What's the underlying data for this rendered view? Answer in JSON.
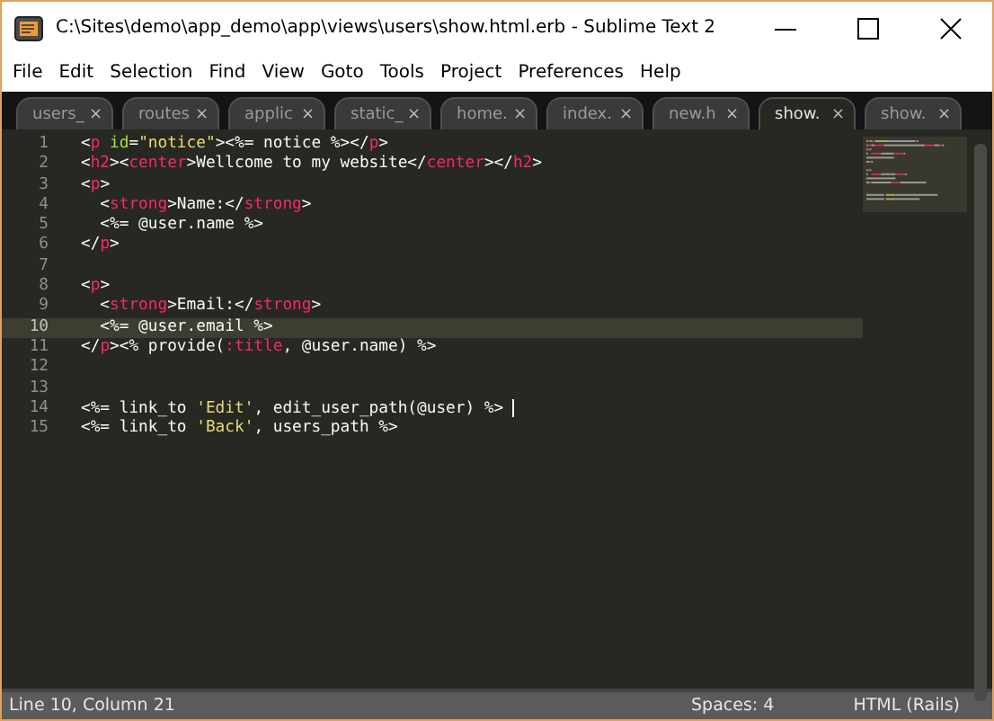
{
  "window": {
    "title": "C:\\Sites\\demo\\app_demo\\app\\views\\users\\show.html.erb - Sublime Text 2"
  },
  "menu": [
    {
      "label": "File"
    },
    {
      "label": "Edit"
    },
    {
      "label": "Selection"
    },
    {
      "label": "Find"
    },
    {
      "label": "View"
    },
    {
      "label": "Goto"
    },
    {
      "label": "Tools"
    },
    {
      "label": "Project"
    },
    {
      "label": "Preferences"
    },
    {
      "label": "Help"
    }
  ],
  "tabs": [
    {
      "label": "users_",
      "close": "×",
      "selected": false
    },
    {
      "label": "routes",
      "close": "×",
      "selected": false
    },
    {
      "label": "applic",
      "close": "×",
      "selected": false
    },
    {
      "label": "static_",
      "close": "×",
      "selected": false
    },
    {
      "label": "home.",
      "close": "×",
      "selected": false
    },
    {
      "label": "index.",
      "close": "×",
      "selected": false
    },
    {
      "label": "new.h",
      "close": "×",
      "selected": false
    },
    {
      "label": "show.",
      "close": "×",
      "selected": true
    },
    {
      "label": "show.",
      "close": "×",
      "selected": false
    }
  ],
  "editor": {
    "lines": [
      {
        "number": "1",
        "current": false,
        "tokens": [
          {
            "kind": "plain",
            "text": "<"
          },
          {
            "kind": "tag",
            "text": "p"
          },
          {
            "kind": "attr",
            "text": " id"
          },
          {
            "kind": "plain",
            "text": "="
          },
          {
            "kind": "string",
            "text": "\"notice\""
          },
          {
            "kind": "plain",
            "text": "><%= notice %></"
          },
          {
            "kind": "tag",
            "text": "p"
          },
          {
            "kind": "plain",
            "text": ">"
          }
        ]
      },
      {
        "number": "2",
        "current": false,
        "tokens": [
          {
            "kind": "plain",
            "text": "<"
          },
          {
            "kind": "tag",
            "text": "h2"
          },
          {
            "kind": "plain",
            "text": "><"
          },
          {
            "kind": "tag",
            "text": "center"
          },
          {
            "kind": "plain",
            "text": ">Wellcome to my website</"
          },
          {
            "kind": "tag",
            "text": "center"
          },
          {
            "kind": "plain",
            "text": "></"
          },
          {
            "kind": "tag",
            "text": "h2"
          },
          {
            "kind": "plain",
            "text": ">"
          }
        ]
      },
      {
        "number": "3",
        "current": false,
        "tokens": [
          {
            "kind": "plain",
            "text": "<"
          },
          {
            "kind": "tag",
            "text": "p"
          },
          {
            "kind": "plain",
            "text": ">"
          }
        ]
      },
      {
        "number": "4",
        "current": false,
        "tokens": [
          {
            "kind": "plain",
            "text": "  <"
          },
          {
            "kind": "tag",
            "text": "strong"
          },
          {
            "kind": "plain",
            "text": ">Name:</"
          },
          {
            "kind": "tag",
            "text": "strong"
          },
          {
            "kind": "plain",
            "text": ">"
          }
        ]
      },
      {
        "number": "5",
        "current": false,
        "tokens": [
          {
            "kind": "plain",
            "text": "  <%= @user.name %>"
          }
        ]
      },
      {
        "number": "6",
        "current": false,
        "tokens": [
          {
            "kind": "plain",
            "text": "</"
          },
          {
            "kind": "tag",
            "text": "p"
          },
          {
            "kind": "plain",
            "text": ">"
          }
        ]
      },
      {
        "number": "7",
        "current": false
      },
      {
        "number": "8",
        "current": false,
        "tokens": [
          {
            "kind": "plain",
            "text": "<"
          },
          {
            "kind": "tag",
            "text": "p"
          },
          {
            "kind": "plain",
            "text": ">"
          }
        ]
      },
      {
        "number": "9",
        "current": false,
        "tokens": [
          {
            "kind": "plain",
            "text": "  <"
          },
          {
            "kind": "tag",
            "text": "strong"
          },
          {
            "kind": "plain",
            "text": ">Email:</"
          },
          {
            "kind": "tag",
            "text": "strong"
          },
          {
            "kind": "plain",
            "text": ">"
          }
        ]
      },
      {
        "number": "10",
        "current": true,
        "tokens": [
          {
            "kind": "plain",
            "text": "  <%= @user.email %>"
          }
        ]
      },
      {
        "number": "11",
        "current": false,
        "tokens": [
          {
            "kind": "plain",
            "text": "</"
          },
          {
            "kind": "tag",
            "text": "p"
          },
          {
            "kind": "plain",
            "text": "><% provide("
          },
          {
            "kind": "tag",
            "text": ":title"
          },
          {
            "kind": "plain",
            "text": ", @user.name) %>"
          }
        ]
      },
      {
        "number": "12",
        "current": false
      },
      {
        "number": "13",
        "current": false
      },
      {
        "number": "14",
        "current": false,
        "cursor": true,
        "tokens": [
          {
            "kind": "plain",
            "text": "<%= link_to "
          },
          {
            "kind": "string",
            "text": "'Edit'"
          },
          {
            "kind": "plain",
            "text": ", edit_user_path(@user) %> "
          }
        ]
      },
      {
        "number": "15",
        "current": false,
        "tokens": [
          {
            "kind": "plain",
            "text": "<%= link_to "
          },
          {
            "kind": "string",
            "text": "'Back'"
          },
          {
            "kind": "plain",
            "text": ", users_path %>"
          }
        ]
      }
    ]
  },
  "status_bar": {
    "position": "Line 10, Column 21",
    "indentation": "Spaces: 4",
    "syntax": "HTML (Rails)"
  }
}
